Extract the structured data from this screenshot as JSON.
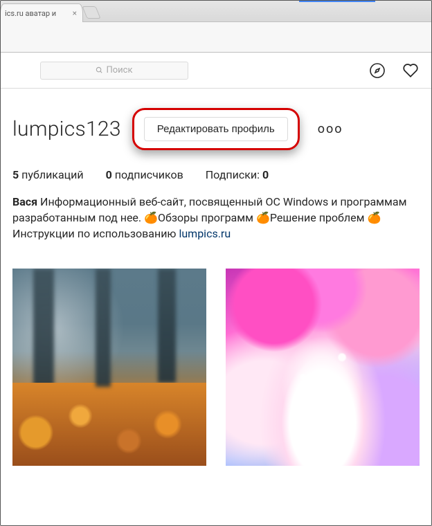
{
  "browser": {
    "tab_title": "ics.ru аватар и",
    "tab_close": "×"
  },
  "nav": {
    "search_placeholder": "Поиск"
  },
  "profile": {
    "username": "lumpics123",
    "edit_label": "Редактировать профиль",
    "options_glyph": "ooo"
  },
  "stats": {
    "posts_count": "5",
    "posts_label": "публикаций",
    "followers_count": "0",
    "followers_label": "подписчиков",
    "following_label": "Подписки:",
    "following_count": "0"
  },
  "bio": {
    "name": "Вася",
    "text1": "Информационный веб-сайт, посвященный ОС Windows и программам разработанным под нее.",
    "seg1": "Обзоры программ",
    "seg2": "Решение проблем",
    "seg3": "Инструкции по использованию",
    "link": "lumpics.ru",
    "emoji": "🍊"
  }
}
